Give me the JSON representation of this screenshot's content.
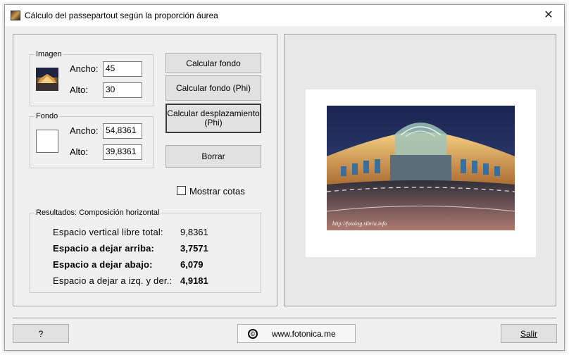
{
  "window": {
    "title": "Cálculo del  passepartout según la proporción áurea",
    "close_glyph": "✕"
  },
  "imagen": {
    "legend": "Imagen",
    "ancho_label": "Ancho:",
    "ancho_value": "45",
    "alto_label": "Alto:",
    "alto_value": "30"
  },
  "fondo": {
    "legend": "Fondo",
    "ancho_label": "Ancho:",
    "ancho_value": "54,8361",
    "alto_label": "Alto:",
    "alto_value": "39,8361"
  },
  "buttons": {
    "calcular_fondo": "Calcular fondo",
    "calcular_fondo_phi": "Calcular fondo (Phi)",
    "calcular_desplazamiento_line1": "Calcular desplazamiento",
    "calcular_desplazamiento_line2": "(Phi)",
    "borrar": "Borrar",
    "help": "?",
    "salir": "Salir"
  },
  "mostrar_cotas": {
    "label": "Mostrar cotas",
    "checked": false
  },
  "resultados": {
    "legend": "Resultados: Composición horizontal",
    "rows": [
      {
        "label": "Espacio vertical libre total:",
        "value": "9,8361",
        "bold_label": false,
        "bold_value": false
      },
      {
        "label": "Espacio a dejar arriba:",
        "value": "3,7571",
        "bold_label": true,
        "bold_value": true
      },
      {
        "label": "Espacio a dejar abajo:",
        "value": "6,079",
        "bold_label": true,
        "bold_value": true
      },
      {
        "label": "Espacio a dejar a izq. y der.:",
        "value": "4,9181",
        "bold_label": false,
        "bold_value": true
      }
    ]
  },
  "preview": {
    "watermark": "http://fotolog.sibria.info"
  },
  "footer": {
    "copyright_glyph": "©",
    "link_text": "www.fotonica.me"
  },
  "colors": {
    "window_bg": "#f0f0f0",
    "preview_bg": "#e8e8e8",
    "button_bg": "#e1e1e1"
  }
}
